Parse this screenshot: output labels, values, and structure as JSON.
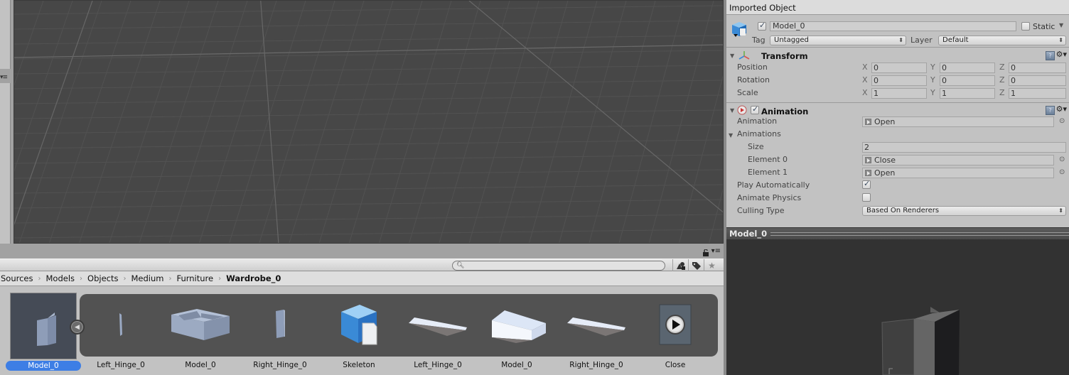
{
  "inspector": {
    "title": "Imported Object",
    "object_name": "Model_0",
    "active": true,
    "static_label": "Static",
    "static_checked": false,
    "tag_label": "Tag",
    "tag_value": "Untagged",
    "layer_label": "Layer",
    "layer_value": "Default"
  },
  "transform": {
    "title": "Transform",
    "rows": [
      {
        "label": "Position",
        "x": "0",
        "y": "0",
        "z": "0"
      },
      {
        "label": "Rotation",
        "x": "0",
        "y": "0",
        "z": "0"
      },
      {
        "label": "Scale",
        "x": "1",
        "y": "1",
        "z": "1"
      }
    ],
    "axes": {
      "x": "X",
      "y": "Y",
      "z": "Z"
    }
  },
  "animation": {
    "title": "Animation",
    "enabled": true,
    "animation_label": "Animation",
    "animation_value": "Open",
    "animations_label": "Animations",
    "size_label": "Size",
    "size_value": "2",
    "element0_label": "Element 0",
    "element0_value": "Close",
    "element1_label": "Element 1",
    "element1_value": "Open",
    "play_auto_label": "Play Automatically",
    "play_auto": true,
    "animate_physics_label": "Animate Physics",
    "animate_physics": false,
    "culling_label": "Culling Type",
    "culling_value": "Based On Renderers"
  },
  "preview": {
    "title": "Model_0"
  },
  "project": {
    "search_placeholder": "",
    "breadcrumb": [
      "Sources",
      "Models",
      "Objects",
      "Medium",
      "Furniture",
      "Wardrobe_0"
    ],
    "selected_asset": "Model_0",
    "sub_assets": [
      {
        "label": "Left_Hinge_0",
        "icon": "mesh-thin-panel-icon"
      },
      {
        "label": "Model_0",
        "icon": "mesh-box-icon"
      },
      {
        "label": "Right_Hinge_0",
        "icon": "mesh-door-icon"
      },
      {
        "label": "Skeleton",
        "icon": "prefab-cube-icon"
      },
      {
        "label": "Left_Hinge_0",
        "icon": "mesh-flat-panel-icon"
      },
      {
        "label": "Model_0",
        "icon": "mesh-block-icon"
      },
      {
        "label": "Right_Hinge_0",
        "icon": "mesh-flat-panel-icon"
      },
      {
        "label": "Close",
        "icon": "animation-clip-icon"
      }
    ]
  }
}
